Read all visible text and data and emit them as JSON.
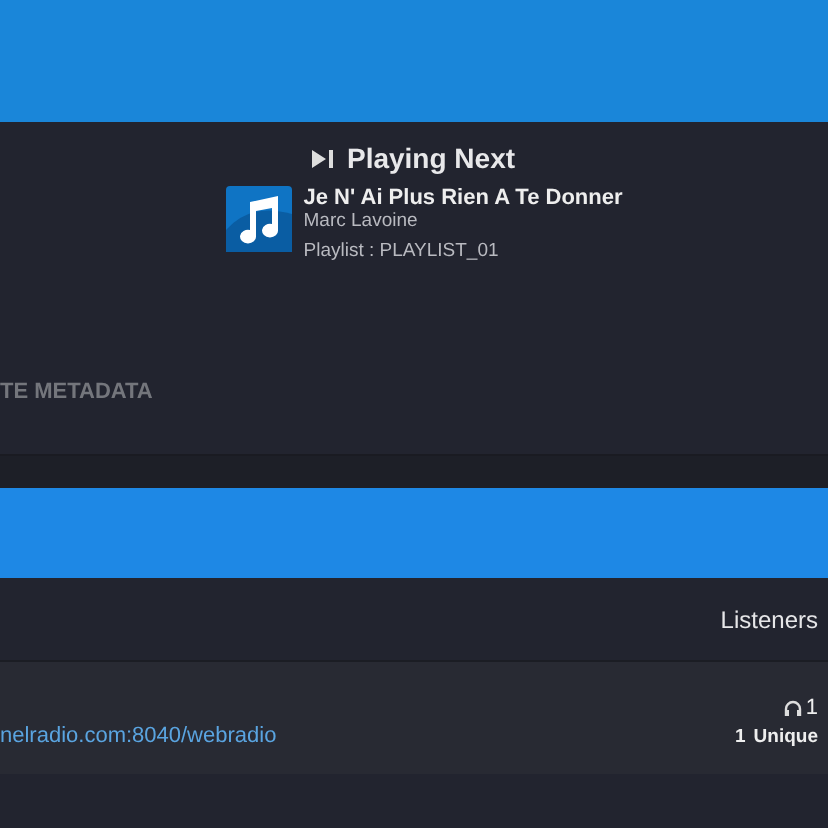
{
  "playing_next": {
    "heading": "Playing Next",
    "song": {
      "title": "Je N' Ai Plus Rien A Te Donner",
      "artist": "Marc Lavoine",
      "playlist": "Playlist : PLAYLIST_01"
    }
  },
  "metadata_button": {
    "label": "TE METADATA"
  },
  "streams": {
    "columns": [
      {
        "label": "Listeners"
      }
    ],
    "rows": [
      {
        "url": "nelradio.com:8040/webradio",
        "listeners": "1",
        "unique_count": "1",
        "unique_label": "Unique"
      }
    ]
  }
}
